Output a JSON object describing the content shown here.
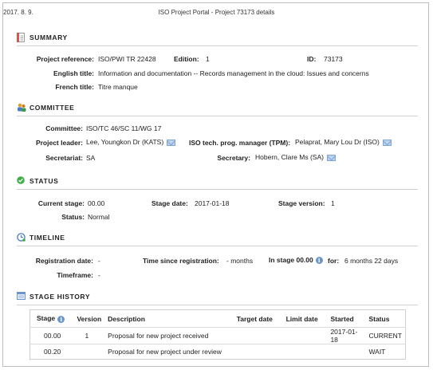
{
  "header": {
    "date": "2017. 8. 9.",
    "title": "ISO Project Portal - Project 73173 details"
  },
  "summary": {
    "title": "SUMMARY",
    "project_reference_label": "Project reference:",
    "project_reference": "ISO/PWI TR 22428",
    "edition_label": "Edition:",
    "edition": "1",
    "id_label": "ID:",
    "id": "73173",
    "english_title_label": "English title:",
    "english_title": "Information and documentation -- Records management in the cloud: Issues and concerns",
    "french_title_label": "French title:",
    "french_title": "Titre manque"
  },
  "committee": {
    "title": "COMMITTEE",
    "committee_label": "Committee:",
    "committee": "ISO/TC 46/SC 11/WG 17",
    "project_leader_label": "Project leader:",
    "project_leader": "Lee, Youngkon Dr (KATS)",
    "tpm_label": "ISO tech. prog. manager (TPM):",
    "tpm": "Pelaprat, Mary Lou Dr (ISO)",
    "secretariat_label": "Secretariat:",
    "secretariat": "SA",
    "secretary_label": "Secretary:",
    "secretary": "Hobern, Clare Ms (SA)"
  },
  "status": {
    "title": "STATUS",
    "current_stage_label": "Current stage:",
    "current_stage": "00.00",
    "stage_date_label": "Stage date:",
    "stage_date": "2017-01-18",
    "stage_version_label": "Stage version:",
    "stage_version": "1",
    "status_label": "Status:",
    "status": "Normal"
  },
  "timeline": {
    "title": "TIMELINE",
    "registration_date_label": "Registration date:",
    "registration_date": "-",
    "time_since_label": "Time since registration:",
    "time_since": "- months",
    "in_stage_label": "In stage 00.00",
    "for_label": "for:",
    "for_value": "6 months 22 days",
    "timeframe_label": "Timeframe:",
    "timeframe": "-"
  },
  "stage_history": {
    "title": "STAGE HISTORY",
    "columns": [
      "Stage",
      "Version",
      "Description",
      "Target date",
      "Limit date",
      "Started",
      "Status"
    ],
    "rows": [
      {
        "stage": "00.00",
        "version": "1",
        "description": "Proposal for new project received",
        "target": "",
        "limit": "",
        "started": "2017-01-18",
        "status": "CURRENT"
      },
      {
        "stage": "00.20",
        "version": "",
        "description": "Proposal for new project under review",
        "target": "",
        "limit": "",
        "started": "",
        "status": "WAIT"
      }
    ]
  },
  "colors": {
    "status_green": "#3fae49",
    "info_blue": "#6a95cf",
    "rule_gray": "#cfcfcf"
  }
}
